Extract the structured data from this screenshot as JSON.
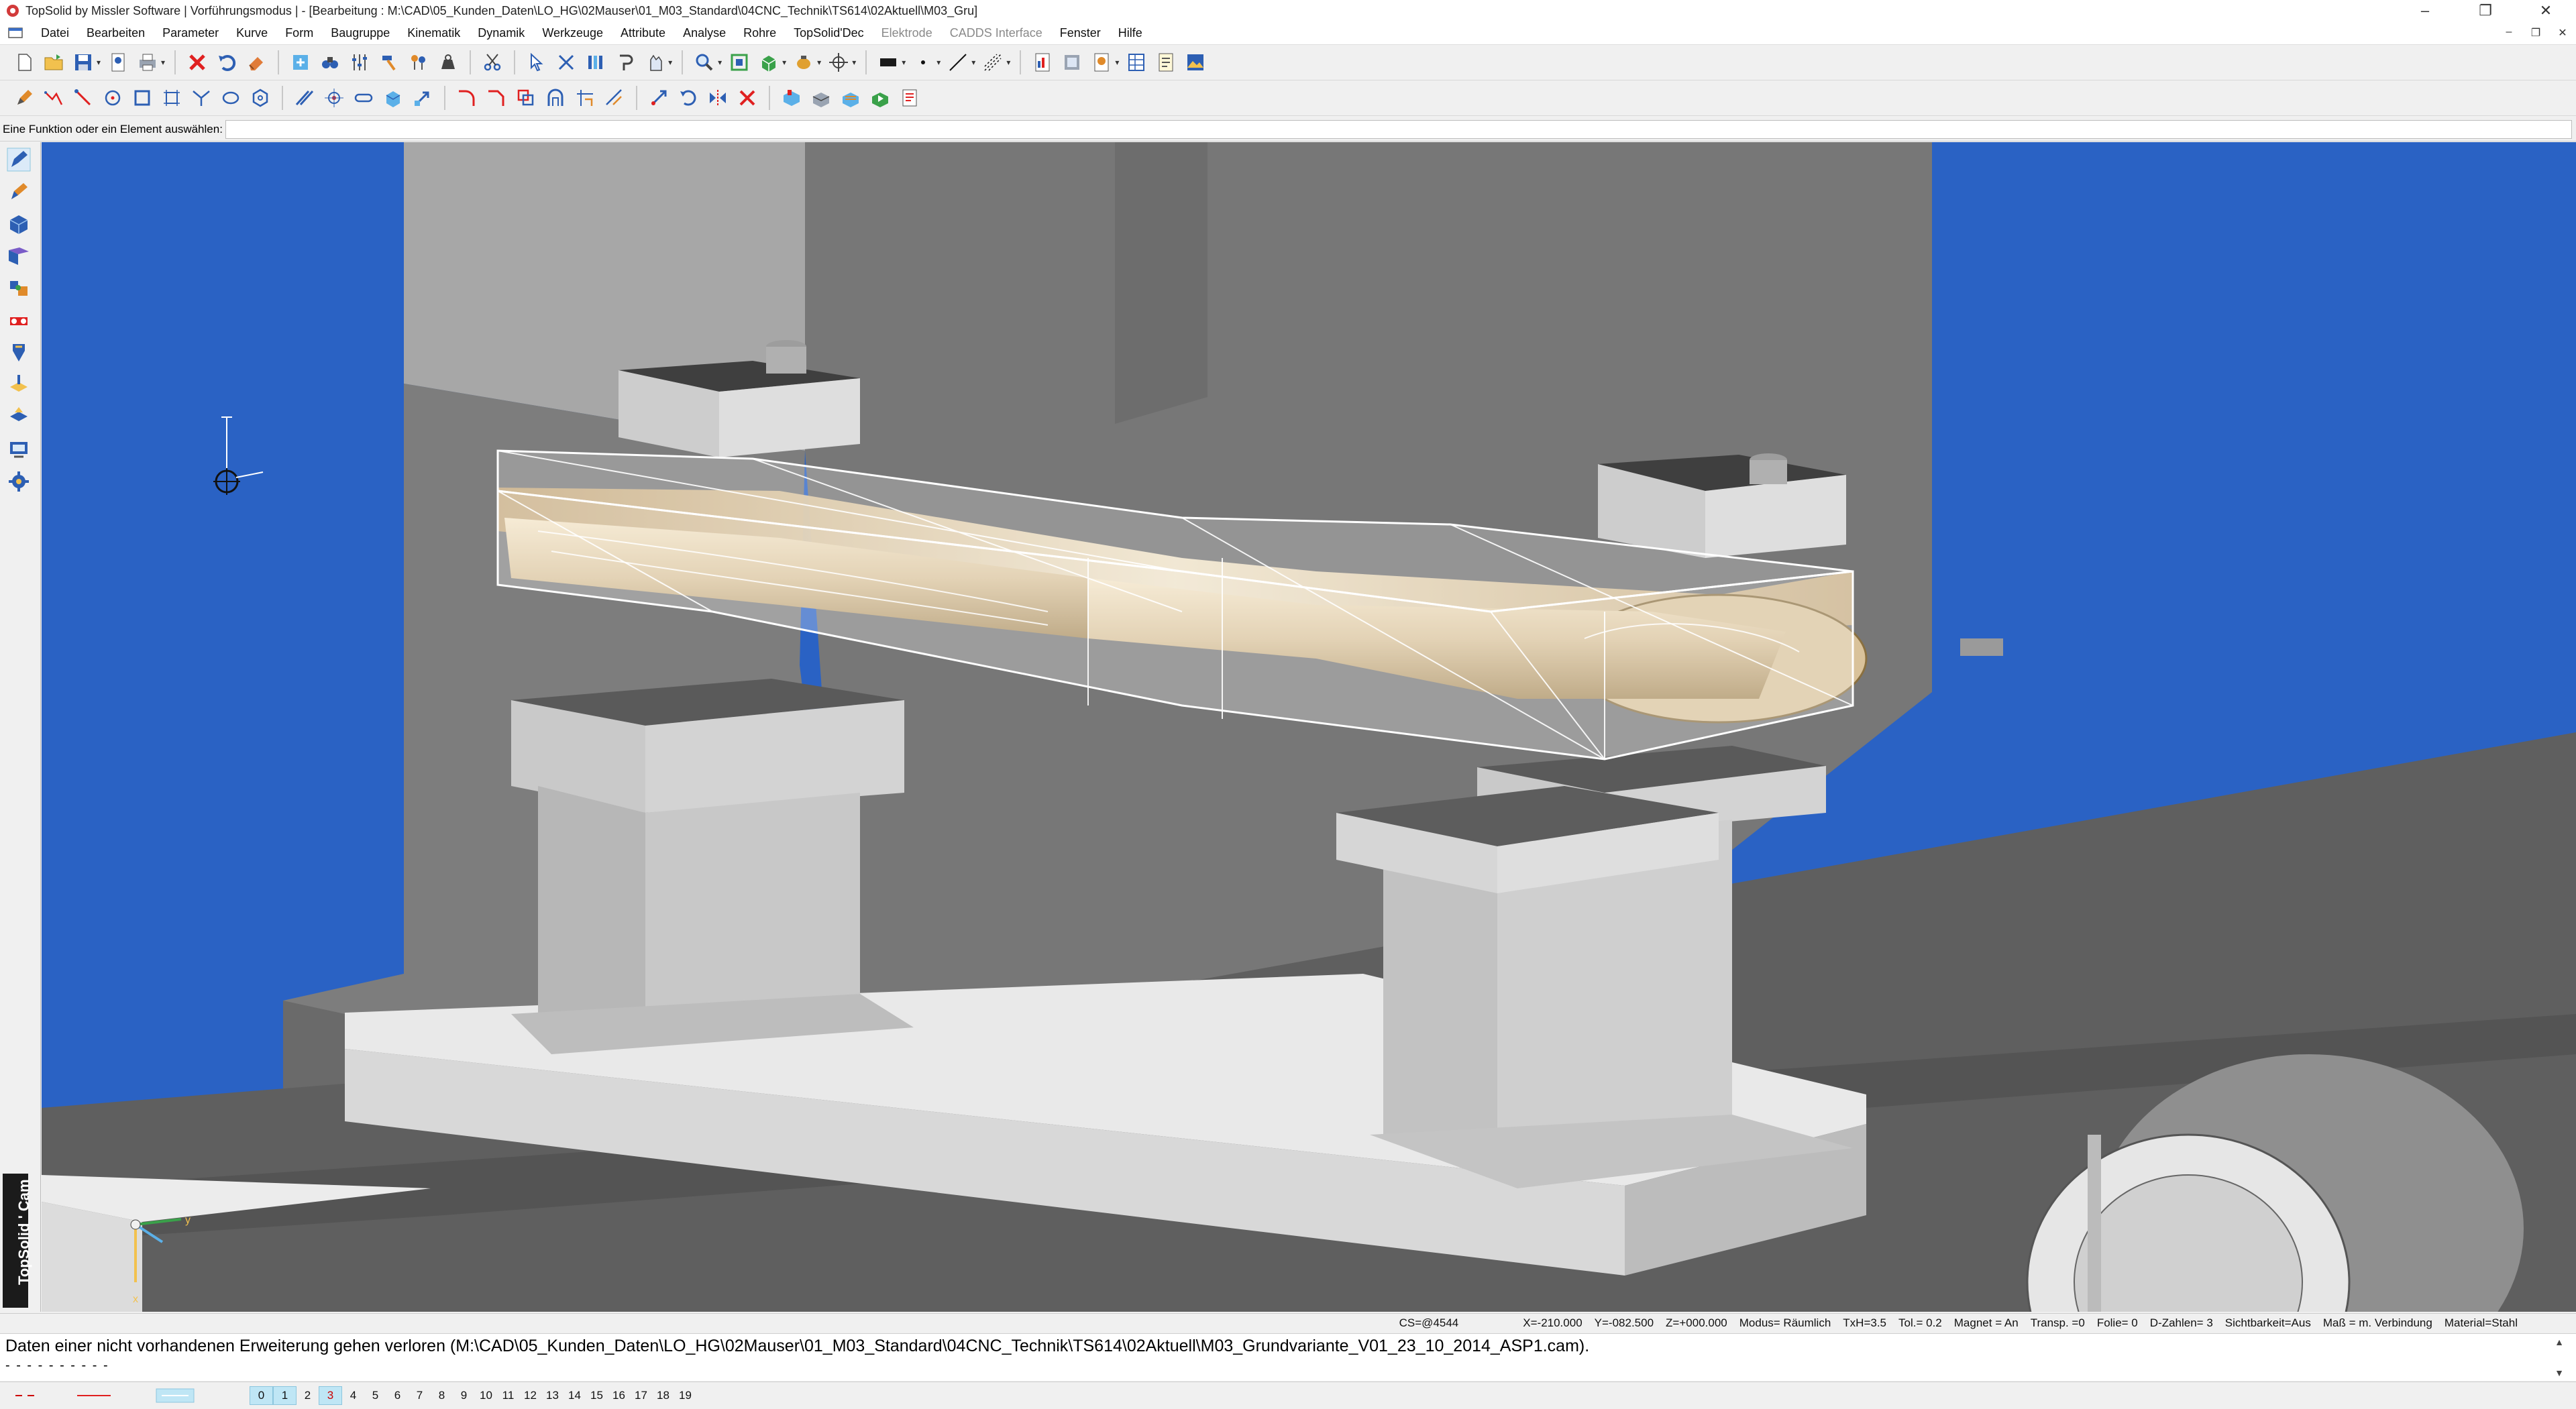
{
  "window": {
    "title": "TopSolid by Missler Software | Vorführungsmodus | - [Bearbeitung : M:\\CAD\\05_Kunden_Daten\\LO_HG\\02Mauser\\01_M03_Standard\\04CNC_Technik\\TS614\\02Aktuell\\M03_Gru]",
    "minimize": "–",
    "restore": "❐",
    "close": "✕"
  },
  "menu": {
    "items": [
      "Datei",
      "Bearbeiten",
      "Parameter",
      "Kurve",
      "Form",
      "Baugruppe",
      "Kinematik",
      "Dynamik",
      "Werkzeuge",
      "Attribute",
      "Analyse",
      "Rohre",
      "TopSolid'Dec",
      "Elektrode",
      "CADDS Interface",
      "Fenster",
      "Hilfe"
    ],
    "disabled": [
      "Elektrode",
      "CADDS Interface"
    ],
    "mdi": [
      "–",
      "❐",
      "✕"
    ]
  },
  "prompt": {
    "label": "Eine Funktion oder ein Element auswählen:",
    "value": ""
  },
  "brand": {
    "text": "TopSolid ' Cam"
  },
  "status": {
    "cs": "CS=@4544",
    "x": "X=-210.000",
    "y": "Y=-082.500",
    "z": "Z=+000.000",
    "modus": "Modus= Räumlich",
    "txh": "TxH=3.5",
    "tol": "Tol.= 0.2",
    "magnet": "Magnet = An",
    "transp": "Transp. =0",
    "folie": "Folie= 0",
    "dzahlen": "D-Zahlen= 3",
    "sichtbarkeit": "Sichtbarkeit=Aus",
    "mass": "Maß = m. Verbindung",
    "material": "Material=Stahl"
  },
  "message": {
    "text": "Daten einer nicht vorhandenen Erweiterung gehen verloren (M:\\CAD\\05_Kunden_Daten\\LO_HG\\02Mauser\\01_M03_Standard\\04CNC_Technik\\TS614\\02Aktuell\\M03_Grundvariante_V01_23_10_2014_ASP1.cam).",
    "dashes": "- - - - - - - - - -"
  },
  "layers": [
    "0",
    "1",
    "2",
    "3",
    "4",
    "5",
    "6",
    "7",
    "8",
    "9",
    "10",
    "11",
    "12",
    "13",
    "14",
    "15",
    "16",
    "17",
    "18",
    "19"
  ],
  "colors": {
    "viewport_bg": "#2a62c4",
    "part": "#d9c29a",
    "fixture": "#b8b8b8",
    "bed": "#5f5f5f"
  }
}
